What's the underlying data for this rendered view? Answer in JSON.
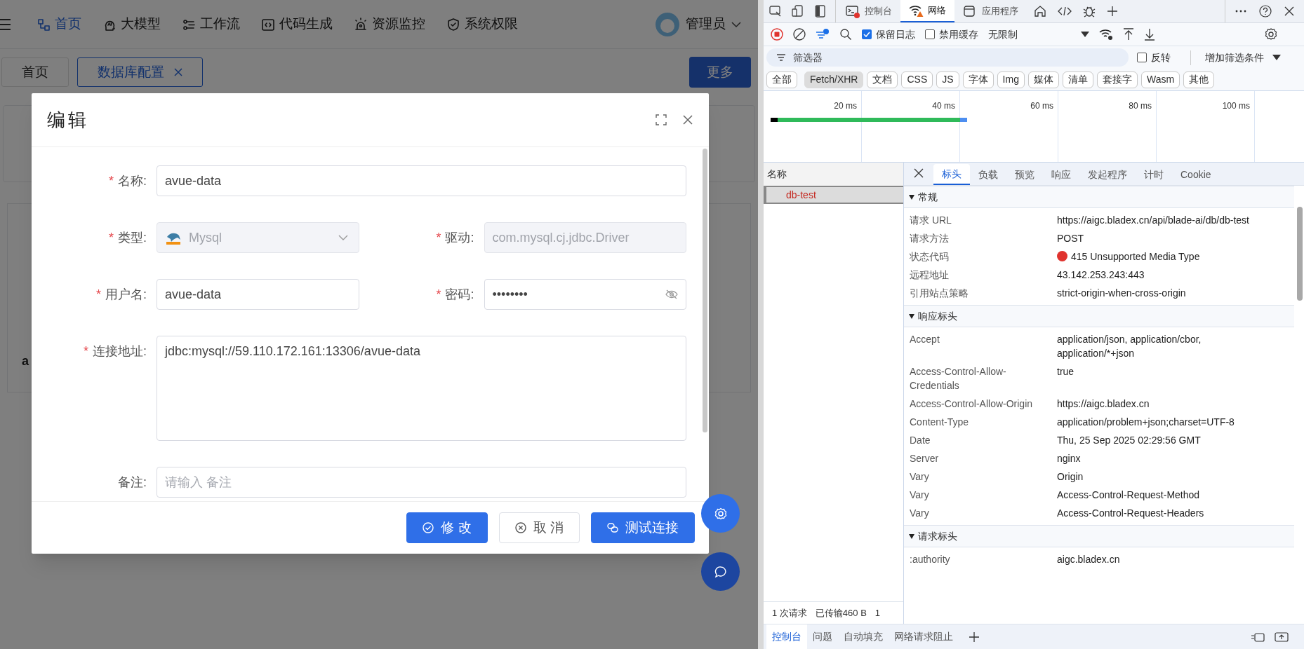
{
  "app": {
    "nav": [
      {
        "label": "首页",
        "selected": true
      },
      {
        "label": "大模型",
        "selected": false
      },
      {
        "label": "工作流",
        "selected": false
      },
      {
        "label": "代码生成",
        "selected": false
      },
      {
        "label": "资源监控",
        "selected": false
      },
      {
        "label": "系统权限",
        "selected": false
      }
    ],
    "user": "管理员",
    "tabs": [
      {
        "label": "首页",
        "selected": false,
        "closable": false
      },
      {
        "label": "数据库配置",
        "selected": true,
        "closable": true
      }
    ],
    "more_button": "更多",
    "table_cell": "a"
  },
  "dialog": {
    "title": "编辑",
    "rows": [
      [
        {
          "label": "名称:",
          "mark": "*",
          "kind": "input",
          "value": "avue-data",
          "disabled": false
        }
      ],
      [
        {
          "label": "类型:",
          "mark": "*",
          "kind": "select",
          "value": "Mysql",
          "disabled": true
        },
        {
          "label": "驱动:",
          "mark": "*",
          "kind": "input",
          "value": "com.mysql.cj.jdbc.Driver",
          "disabled": true
        }
      ],
      [
        {
          "label": "用户名:",
          "mark": "*",
          "kind": "input",
          "value": "avue-data",
          "disabled": false
        },
        {
          "label": "密码:",
          "mark": "*",
          "kind": "password",
          "value": "••••••••",
          "disabled": false
        }
      ],
      [
        {
          "label": "连接地址:",
          "mark": "*",
          "kind": "textarea",
          "value": "jdbc:mysql://59.110.172.161:13306/avue-data",
          "disabled": false
        }
      ],
      [
        {
          "label": "备注:",
          "kind": "input",
          "placeholder": "请输入 备注",
          "disabled": false
        }
      ]
    ],
    "buttons": [
      {
        "label": "修 改",
        "kind": "primary"
      },
      {
        "label": "取 消",
        "kind": "default"
      },
      {
        "label": "测试连接",
        "kind": "primary"
      }
    ]
  },
  "devtools": {
    "tabs": [
      {
        "label": "控制台",
        "selected": false
      },
      {
        "label": "网络",
        "selected": true
      },
      {
        "label": "应用程序",
        "selected": false
      }
    ],
    "preserve_log": {
      "label": "保留日志",
      "checked": true
    },
    "disable_cache": {
      "label": "禁用缓存",
      "checked": false
    },
    "throttle": "无限制",
    "filter_placeholder": "筛选器",
    "invert": {
      "label": "反转",
      "checked": false
    },
    "more_filters": "增加筛选条件",
    "type_chips": [
      {
        "label": "全部",
        "selected": false
      },
      {
        "label": "Fetch/XHR",
        "selected": true
      },
      {
        "label": "文档",
        "selected": false
      },
      {
        "label": "CSS",
        "selected": false
      },
      {
        "label": "JS",
        "selected": false
      },
      {
        "label": "字体",
        "selected": false
      },
      {
        "label": "Img",
        "selected": false
      },
      {
        "label": "媒体",
        "selected": false
      },
      {
        "label": "清单",
        "selected": false
      },
      {
        "label": "套接字",
        "selected": false
      },
      {
        "label": "Wasm",
        "selected": false
      },
      {
        "label": "其他",
        "selected": false
      }
    ],
    "timeline_ticks": [
      "20 ms",
      "40 ms",
      "60 ms",
      "80 ms",
      "100 ms"
    ],
    "list_header": "名称",
    "requests": [
      {
        "name": "db-test",
        "selected": true,
        "failed": true
      }
    ],
    "detail_tabs": [
      {
        "label": "标头",
        "selected": true
      },
      {
        "label": "负载",
        "selected": false
      },
      {
        "label": "预览",
        "selected": false
      },
      {
        "label": "响应",
        "selected": false
      },
      {
        "label": "发起程序",
        "selected": false
      },
      {
        "label": "计时",
        "selected": false
      },
      {
        "label": "Cookie",
        "selected": false
      }
    ],
    "sections": [
      {
        "title": "常规",
        "expanded": true,
        "rows": [
          {
            "key": "请求 URL",
            "value": "https://aigc.bladex.cn/api/blade-ai/db/db-test"
          },
          {
            "key": "请求方法",
            "value": "POST"
          },
          {
            "key": "状态代码",
            "value": "415 Unsupported Media Type",
            "color": "#e0332e"
          },
          {
            "key": "远程地址",
            "value": "43.142.253.243:443"
          },
          {
            "key": "引用站点策略",
            "value": "strict-origin-when-cross-origin"
          }
        ]
      },
      {
        "title": "响应标头",
        "expanded": true,
        "rows": [
          {
            "key": "Accept",
            "value": "application/json, application/cbor, application/*+json"
          },
          {
            "key": "Access-Control-Allow-Credentials",
            "value": "true"
          },
          {
            "key": "Access-Control-Allow-Origin",
            "value": "https://aigc.bladex.cn"
          },
          {
            "key": "Content-Type",
            "value": "application/problem+json;charset=UTF-8"
          },
          {
            "key": "Date",
            "value": "Thu, 25 Sep 2025 02:29:56 GMT"
          },
          {
            "key": "Server",
            "value": "nginx"
          },
          {
            "key": "Vary",
            "value": "Origin"
          },
          {
            "key": "Vary",
            "value": "Access-Control-Request-Method"
          },
          {
            "key": "Vary",
            "value": "Access-Control-Request-Headers"
          }
        ]
      },
      {
        "title": "请求标头",
        "expanded": true,
        "rows": [
          {
            "key": ":authority",
            "value": "aigc.bladex.cn"
          }
        ]
      }
    ],
    "summary": [
      "1 次请求",
      "已传输460 B",
      "1"
    ],
    "drawer_tabs": [
      {
        "label": "控制台",
        "selected": true
      },
      {
        "label": "问题",
        "selected": false
      },
      {
        "label": "自动填充",
        "selected": false
      },
      {
        "label": "网络请求阻止",
        "selected": false
      }
    ]
  }
}
